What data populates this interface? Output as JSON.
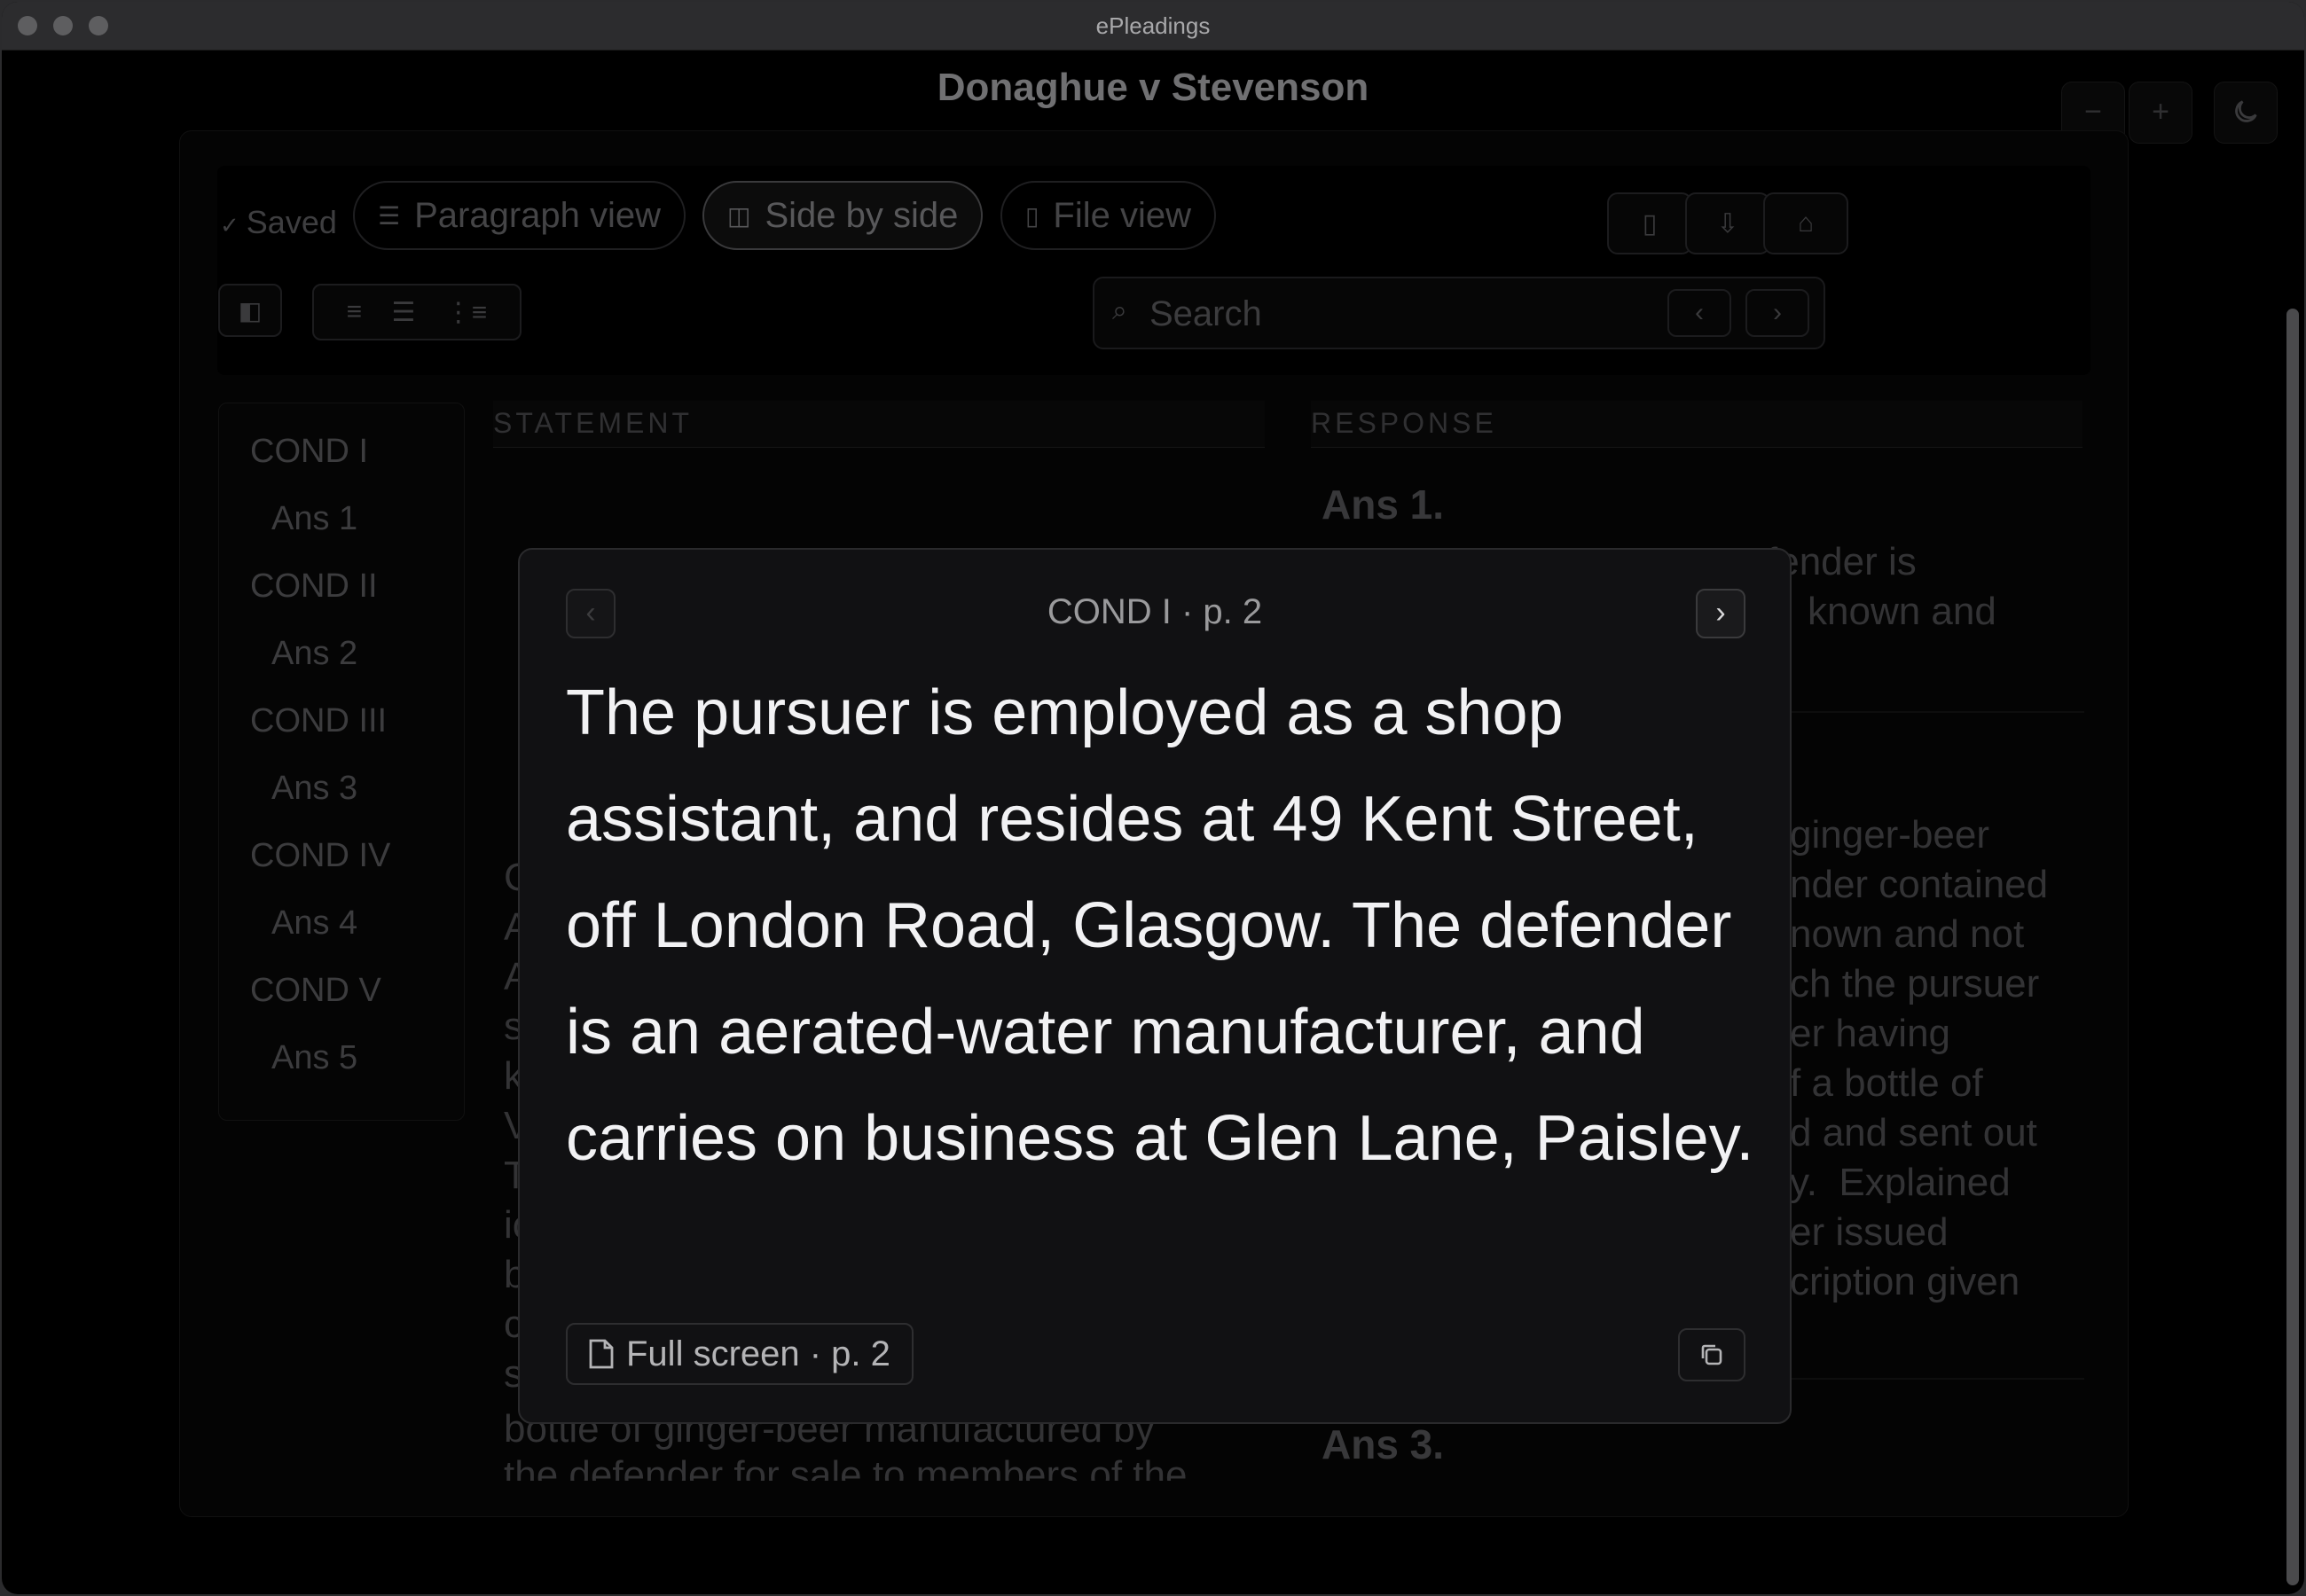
{
  "window": {
    "title": "ePleadings"
  },
  "document": {
    "title": "Donaghue v Stevenson"
  },
  "top_controls": {
    "zoom_out": "−",
    "zoom_in": "+",
    "theme_icon": "moon-icon"
  },
  "toolbar": {
    "saved_label": "Saved",
    "views": [
      {
        "label": "Paragraph view",
        "icon": "paragraph-icon",
        "active": false
      },
      {
        "label": "Side by side",
        "icon": "columns-icon",
        "active": true
      },
      {
        "label": "File view",
        "icon": "file-icon",
        "active": false
      }
    ],
    "search": {
      "placeholder": "Search"
    }
  },
  "sidebar": {
    "items": [
      {
        "label": "COND I",
        "level": 0
      },
      {
        "label": "Ans 1",
        "level": 1
      },
      {
        "label": "COND II",
        "level": 0
      },
      {
        "label": "Ans 2",
        "level": 1
      },
      {
        "label": "COND III",
        "level": 0
      },
      {
        "label": "Ans 3",
        "level": 1
      },
      {
        "label": "COND IV",
        "level": 0
      },
      {
        "label": "Ans 4",
        "level": 1
      },
      {
        "label": "COND V",
        "level": 0
      },
      {
        "label": "Ans 5",
        "level": 1
      }
    ]
  },
  "columns": {
    "statement_header": "STATEMENT",
    "response_header": "RESPONSE"
  },
  "response": {
    "ans1_title": "Ans 1.",
    "ans1_lines": [
      "fender is",
      "known and"
    ],
    "ans2_lines": [
      "ginger-beer",
      "nder contained",
      "nown and not",
      "ch the pursuer",
      "er having",
      "f a bottle of",
      "d and sent out",
      "y.  Explained",
      "er issued",
      "cription given"
    ],
    "ans3_title": "Ans 3."
  },
  "statement": {
    "partial_letters": [
      "C",
      "A",
      "A",
      "s",
      "k",
      "V",
      "T",
      "ic",
      "b",
      "c",
      "s"
    ],
    "bottom_lines": [
      "bottle of ginger-beer manufactured by",
      "the defender for sale to members of the"
    ]
  },
  "modal": {
    "reference": "COND I · p. 2",
    "body": "The pursuer is employed as a shop assistant, and resides at 49 Kent Street, off London Road, Glasgow.  The defender is an aerated-water manufacturer, and carries on business at Glen Lane, Paisley.",
    "full_screen_label": "Full screen · p. 2",
    "prev_icon": "‹",
    "next_icon": "›"
  }
}
